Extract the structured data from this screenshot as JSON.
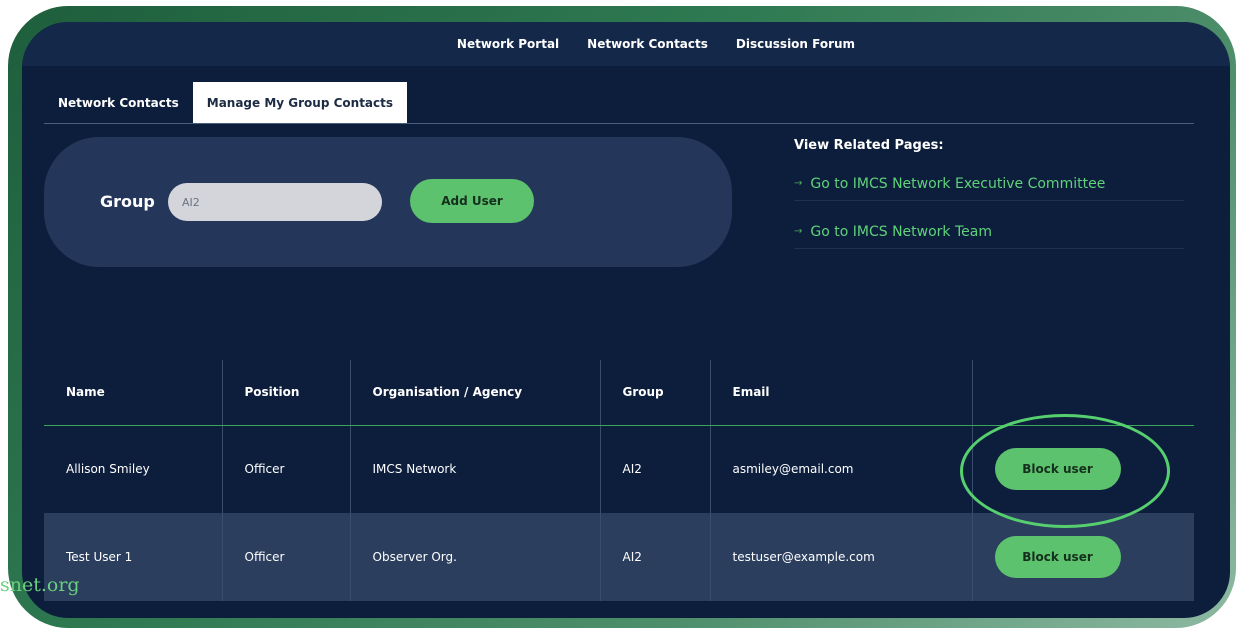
{
  "topnav": {
    "items": [
      "Network Portal",
      "Network Contacts",
      "Discussion Forum"
    ]
  },
  "tabs": [
    {
      "label": "Network Contacts",
      "active": false
    },
    {
      "label": "Manage My Group Contacts",
      "active": true
    }
  ],
  "group_panel": {
    "label": "Group",
    "input_value": "AI2",
    "add_button": "Add User"
  },
  "related": {
    "title": "View Related Pages:",
    "arrow_icon": "→",
    "links": [
      "Go to IMCS Network Executive Committee",
      "Go to IMCS Network Team"
    ]
  },
  "table": {
    "headers": [
      "Name",
      "Position",
      "Organisation / Agency",
      "Group",
      "Email",
      ""
    ],
    "rows": [
      {
        "name": "Allison Smiley",
        "position": "Officer",
        "organisation": "IMCS Network",
        "group": "AI2",
        "email": "asmiley@email.com",
        "action": "Block user"
      },
      {
        "name": "Test User 1",
        "position": "Officer",
        "organisation": "Observer Org.",
        "group": "AI2",
        "email": "testuser@example.com",
        "action": "Block user"
      }
    ]
  },
  "watermark": "snet.org",
  "colors": {
    "background": "#0d1e3d",
    "accent_green": "#5cc26e",
    "panel": "#24375a"
  }
}
